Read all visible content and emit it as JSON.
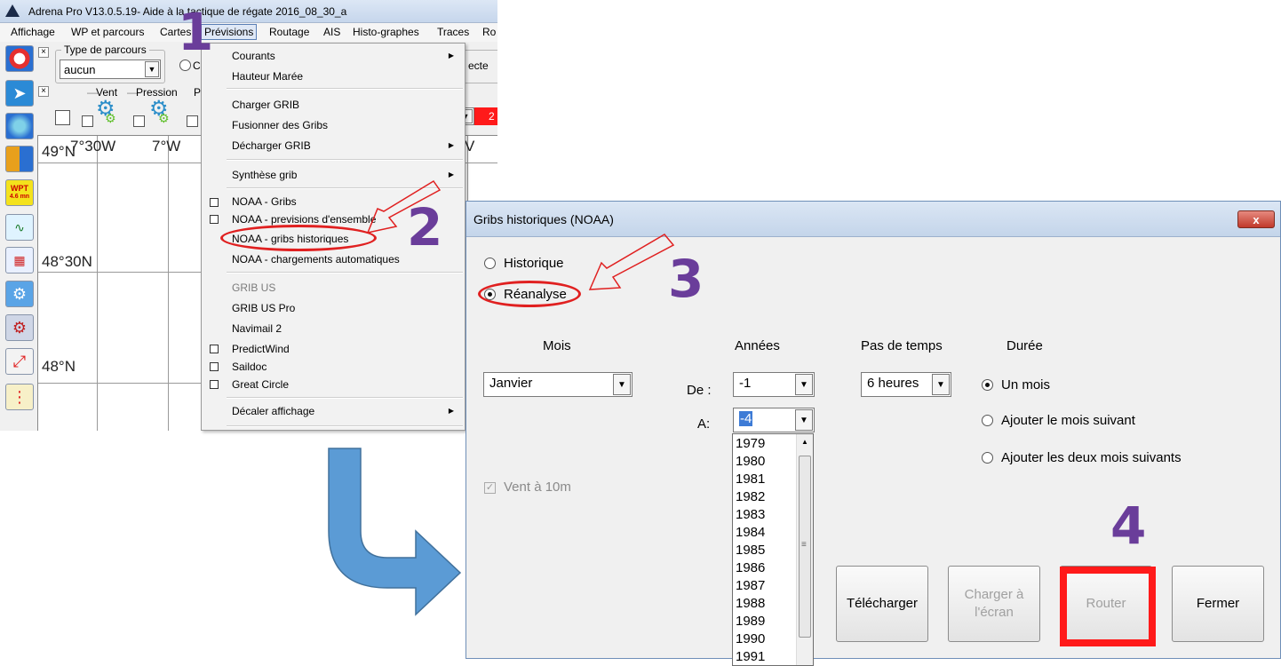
{
  "app": {
    "title": "Adrena Pro V13.0.5.19- Aide à la tactique de régate 2016_08_30_a",
    "menu": [
      "Affichage",
      "WP et parcours",
      "Cartes",
      "Prévisions",
      "Routage",
      "AIS",
      "Histo-graphes",
      "Traces",
      "Ro"
    ],
    "toolbar": {
      "type_parcours_label": "Type de parcours",
      "type_parcours_value": "aucun",
      "vent_label": "Vent",
      "pression_label": "Pression",
      "partial_p": "P",
      "partial_c": "C",
      "partial_ecte": "ecte",
      "partial_red": "2"
    },
    "left_icons": {
      "wpt_label": "WPT",
      "wpt_dist": "4.6 mn"
    },
    "chart": {
      "lon_labels": [
        "7°30W",
        "7°W",
        "V"
      ],
      "lat_labels": [
        "49°N",
        "48°30N",
        "48°N"
      ]
    }
  },
  "previsions_menu": {
    "items": [
      {
        "label": "Courants",
        "submenu": true
      },
      {
        "label": "Hauteur Marée"
      },
      {
        "label": "Charger GRIB"
      },
      {
        "label": "Fusionner des Gribs"
      },
      {
        "label": "Décharger GRIB",
        "submenu": true
      },
      {
        "label": "Synthèse grib",
        "submenu": true
      },
      {
        "label": "NOAA - Gribs",
        "checkbox": true
      },
      {
        "label": "NOAA - previsions d'ensemble",
        "checkbox": true
      },
      {
        "label": "NOAA - gribs historiques"
      },
      {
        "label": "NOAA - chargements automatiques"
      },
      {
        "label": "GRIB US",
        "disabled": true
      },
      {
        "label": "GRIB US Pro"
      },
      {
        "label": "Navimail 2"
      },
      {
        "label": "PredictWind",
        "checkbox": true
      },
      {
        "label": "Saildoc",
        "checkbox": true
      },
      {
        "label": "Great Circle",
        "checkbox": true
      },
      {
        "label": "Décaler affichage",
        "submenu": true
      }
    ]
  },
  "dialog": {
    "title": "Gribs historiques (NOAA)",
    "close_label": "x",
    "radio_historique": "Historique",
    "radio_reanalyse": "Réanalyse",
    "mois_label": "Mois",
    "mois_value": "Janvier",
    "annees_label": "Années",
    "de_label": "De :",
    "de_value": "-1",
    "a_label": "A:",
    "a_value": "-4",
    "pas_label": "Pas de temps",
    "pas_value": "6 heures",
    "duree_label": "Durée",
    "duree_options": [
      "Un mois",
      "Ajouter le mois suivant",
      "Ajouter les deux mois suivants"
    ],
    "vent_checkbox": "Vent à 10m",
    "years": [
      "1979",
      "1980",
      "1981",
      "1982",
      "1983",
      "1984",
      "1985",
      "1986",
      "1987",
      "1988",
      "1989",
      "1990",
      "1991"
    ],
    "buttons": {
      "telecharger": "Télécharger",
      "charger_line1": "Charger à",
      "charger_line2": "l'écran",
      "router": "Router",
      "fermer": "Fermer"
    }
  },
  "annotations": {
    "step1": "1",
    "step2": "2",
    "step3": "3",
    "step4": "4",
    "accent_color": "#6a3d9a",
    "highlight_color": "#e02020",
    "arrow_color": "#5b9bd5"
  }
}
